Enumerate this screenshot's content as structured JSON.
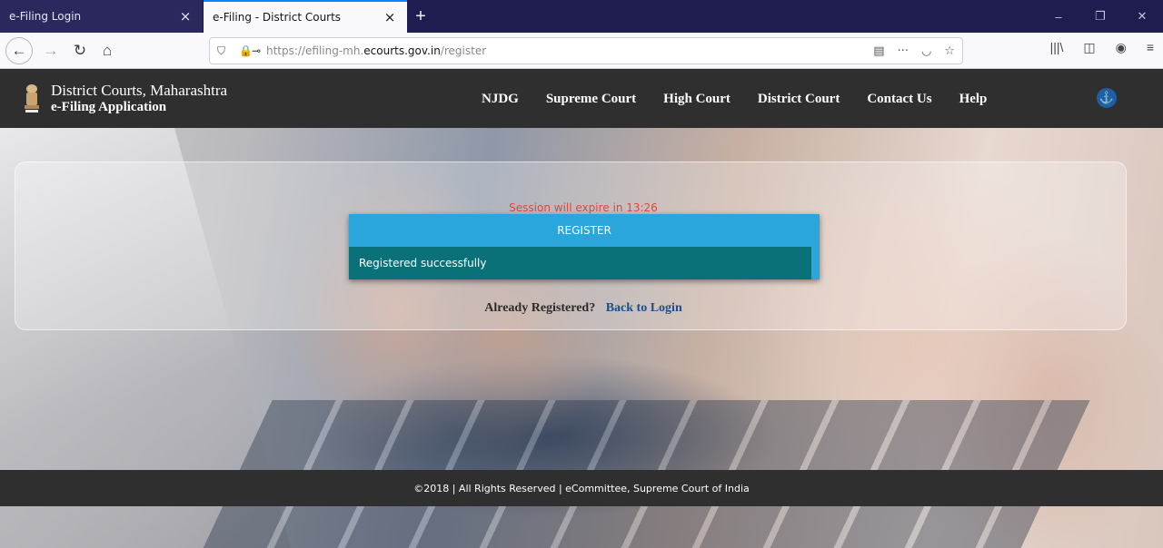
{
  "browser": {
    "tabs": [
      {
        "title": "e-Filing Login",
        "close": "×"
      },
      {
        "title": "e-Filing - District Courts",
        "close": "×"
      }
    ],
    "new_tab": "+",
    "window_controls": {
      "minimize": "–",
      "restore": "❐",
      "close": "✕"
    },
    "nav": {
      "back": "←",
      "forward": "→",
      "reload": "↻",
      "home": "⌂"
    },
    "url": {
      "prefix": "https://efiling-mh.",
      "domain": "ecourts.gov.in",
      "path": "/register"
    },
    "url_actions": {
      "reader": "▤",
      "more": "···",
      "pocket": "◡",
      "bookmark": "☆"
    },
    "toolbar": {
      "library": "|||\\",
      "sidebar": "◫",
      "account": "◉",
      "menu": "≡"
    }
  },
  "site": {
    "brand_line1": "District Courts, Maharashtra",
    "brand_line2": "e-Filing Application",
    "menu": [
      "NJDG",
      "Supreme Court",
      "High Court",
      "District Court",
      "Contact Us",
      "Help"
    ],
    "accessibility_glyph": "⚓"
  },
  "main": {
    "session_text": "Session will expire in 13:26",
    "register_title": "REGISTER",
    "success_message": "Registered successfully",
    "already_registered": "Already Registered?",
    "back_to_login": "Back to Login"
  },
  "footer": {
    "text": "©2018 | All Rights Reserved | eCommittee, Supreme Court of India"
  },
  "colors": {
    "header_bg": "#2f2f2f",
    "register_header": "#2aa6dc",
    "success_bg": "#0b7179",
    "session_text": "#e0463a",
    "link": "#1c4f8a"
  }
}
